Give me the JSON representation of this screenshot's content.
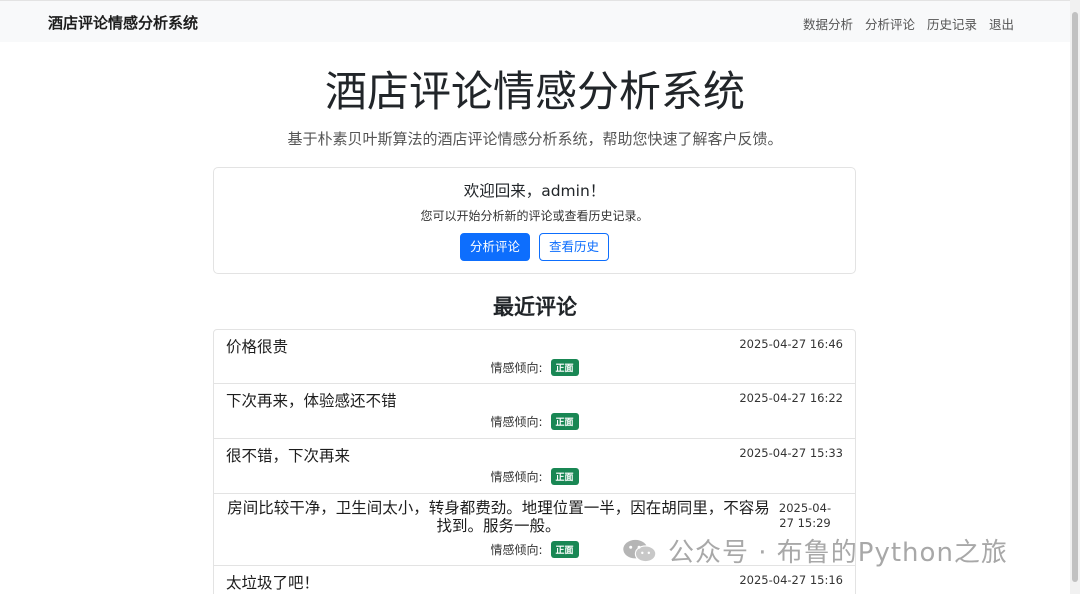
{
  "nav": {
    "brand": "酒店评论情感分析系统",
    "links": [
      "数据分析",
      "分析评论",
      "历史记录",
      "退出"
    ]
  },
  "hero": {
    "title": "酒店评论情感分析系统",
    "subtitle": "基于朴素贝叶斯算法的酒店评论情感分析系统，帮助您快速了解客户反馈。"
  },
  "welcome": {
    "title": "欢迎回来，admin！",
    "desc": "您可以开始分析新的评论或查看历史记录。",
    "primary_button": "分析评论",
    "secondary_button": "查看历史"
  },
  "recent": {
    "title": "最近评论",
    "sentiment_label": "情感倾向:",
    "items": [
      {
        "text": "价格很贵",
        "time": "2025-04-27 16:46",
        "sentiment": "正面"
      },
      {
        "text": "下次再来，体验感还不错",
        "time": "2025-04-27 16:22",
        "sentiment": "正面"
      },
      {
        "text": "很不错，下次再来",
        "time": "2025-04-27 15:33",
        "sentiment": "正面"
      },
      {
        "text": "房间比较干净，卫生间太小，转身都费劲。地理位置一半，因在胡同里，不容易找到。服务一般。",
        "time": "2025-04-27 15:29",
        "sentiment": "正面"
      },
      {
        "text": "太垃圾了吧！",
        "time": "2025-04-27 15:16",
        "sentiment": ""
      }
    ]
  },
  "watermark": {
    "text": "公众号 · 布鲁的Python之旅",
    "icon": "wechat-icon"
  },
  "colors": {
    "primary": "#0d6efd",
    "success": "#198754",
    "navbar_bg": "#f8f9fa"
  }
}
